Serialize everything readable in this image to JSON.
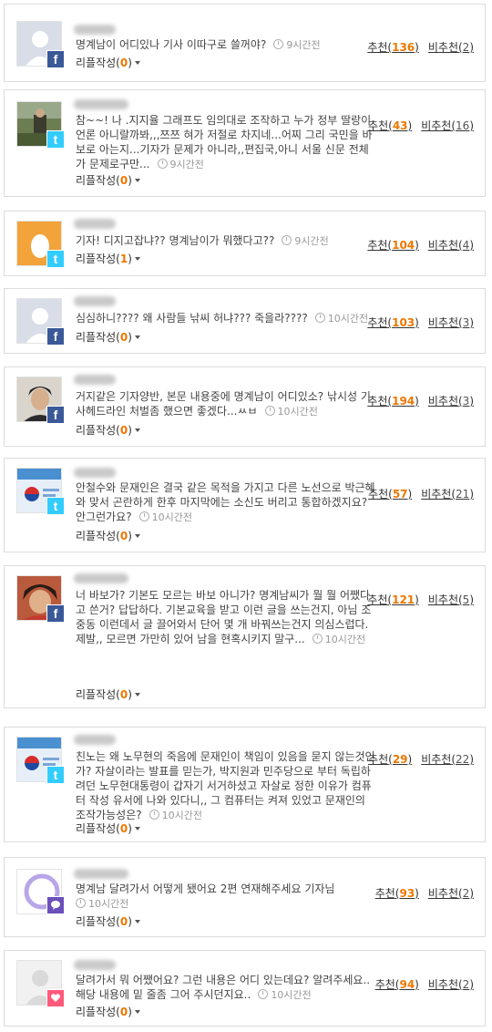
{
  "labels": {
    "recommend": "추천",
    "not_recommend": "비추천",
    "write_reply": "리플작성"
  },
  "colors": {
    "accent": "#ee7700",
    "border": "#dcdcdc"
  },
  "comments": [
    {
      "avatar": "default-facebook-profile",
      "sns": "facebook",
      "body": "명계남이 어디있나 기사 이따구로 쓸꺼야?",
      "time": "9시간전",
      "replies": "0",
      "up": "136",
      "down": "2"
    },
    {
      "avatar": "outdoor-photo",
      "sns": "twitter",
      "body": "참~~! 나 .지지율 그래프도 임의대로 조작하고 누가 정부 딸랑이 언론 아니랄까봐,,,쯔쯔 혀가 저절로 차지네...어찌 그리 국민을 바보로 아는지...기자가 문제가 아니라,,편집국,아니 서울 신문 전체가 문제로구만...",
      "time": "9시간전",
      "replies": "0",
      "up": "43",
      "down": "16"
    },
    {
      "avatar": "egg-twitter-default",
      "sns": "twitter",
      "body": "기자! 디지고잡냐?? 명계남이가 뭐했다고??",
      "time": "9시간전",
      "replies": "1",
      "up": "104",
      "down": "4"
    },
    {
      "avatar": "default-facebook-profile",
      "sns": "facebook",
      "body": "심심하니???? 왜 사람들 낚씨 허냐??? 죽을라????",
      "time": "10시간전",
      "replies": "0",
      "up": "103",
      "down": "3"
    },
    {
      "avatar": "man-photo",
      "sns": "facebook",
      "body": "거지같은 기자양반, 본문 내용중에 명계남이 어디있소? 낚시성 기사헤드라인 처벌좀 했으면 좋겠다...ㅆㅂ",
      "time": "10시간전",
      "replies": "0",
      "up": "194",
      "down": "3"
    },
    {
      "avatar": "korean-flag-banner",
      "sns": "twitter",
      "body": "안철수와 문재인은 결국 같은 목적을 가지고 다른 노선으로 박근혜와 맞서 곤란하게 한후 마지막에는 소신도 버리고 통합하겠지요? 안그런가요?",
      "time": "10시간전",
      "replies": "0",
      "up": "57",
      "down": "21"
    },
    {
      "avatar": "person-photo",
      "sns": "facebook",
      "body": "너 바보가? 기본도 모르는 바보 아니가? 명계남씨가 뭘 뭘 어쨌다고 쓴거? 답답하다. 기본교육을 받고 이런 글을 쓰는건지, 아님 조중동 이런데서 글 끌어와서 단어 몇 개 바꿔쓰는건지 의심스럽다. 제발,, 모르면 가만히 있어 남을 현혹시키지 말구...",
      "time": "10시간전",
      "replies": "0",
      "up": "121",
      "down": "5"
    },
    {
      "avatar": "korean-flag-banner",
      "sns": "twitter",
      "body": "친노는 왜 노무현의 죽음에 문재인이 책임이 있음을 묻지 않는것인가? 자살이라는 발표를 믿는가, 박지원과 민주당으로 부터 독립하려던 노무현대통령이 갑자기 서거하셨고 자살로 정한 이유가 컴퓨터 작성 유서에 나와 있다니,, 그 컴퓨터는 켜져 있었고 문재인의 조작가능성은?",
      "time": "10시간전",
      "replies": "0",
      "up": "29",
      "down": "22"
    },
    {
      "avatar": "purple-ring-logo",
      "sns": "kakao",
      "body": "명계남 달려가서 어떻게 됐어요 2편 연재해주세요 기자님",
      "time": "10시간전",
      "replies": "0",
      "up": "93",
      "down": "2"
    },
    {
      "avatar": "default-kakao-profile",
      "sns": "kakaostory",
      "body": "달려가서 뭐 어쨌어요? 그런 내용은 어디 있는데요? 알려주세요..해당 내용에 밑 줄좀 그어 주시던지요..",
      "time": "10시간전",
      "replies": "0",
      "up": "94",
      "down": "2"
    }
  ]
}
